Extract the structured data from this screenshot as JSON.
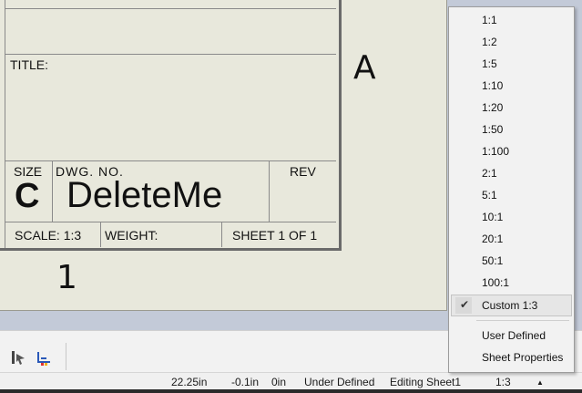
{
  "drawing": {
    "title_label": "TITLE:",
    "size_label": "SIZE",
    "size_value": "C",
    "dwg_no_label": "DWG.  NO.",
    "dwg_no_value": "DeleteMe",
    "rev_label": "REV",
    "scale_label": "SCALE: 1:3",
    "weight_label": "WEIGHT:",
    "sheet_label": "SHEET 1 OF 1",
    "zone_row": "A",
    "zone_col": "1"
  },
  "scale_menu": {
    "items": [
      "1:1",
      "1:2",
      "1:5",
      "1:10",
      "1:20",
      "1:50",
      "1:100",
      "2:1",
      "5:1",
      "10:1",
      "20:1",
      "50:1",
      "100:1"
    ],
    "checked_item": "Custom 1:3",
    "check_mark": "✔",
    "extra_items": [
      "User Defined",
      "Sheet Properties"
    ]
  },
  "status_bar": {
    "x": "22.25in",
    "y": "-0.1in",
    "z": "0in",
    "state": "Under Defined",
    "mode": "Editing Sheet1",
    "scale": "1:3",
    "scale_arrow": "▲"
  },
  "icons": [
    "list-arrow-icon",
    "dimension-pointer-icon",
    "color-axis-icon"
  ]
}
